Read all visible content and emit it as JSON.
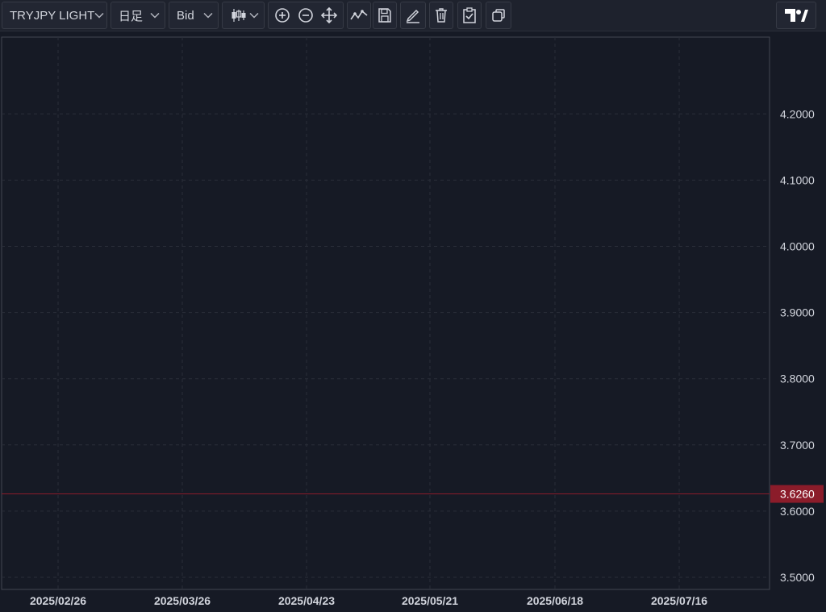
{
  "toolbar": {
    "symbol": "TRYJPY LIGHT",
    "interval": "日足",
    "price_type": "Bid",
    "icons": [
      "candlestick-type-icon",
      "zoom-in-icon",
      "zoom-out-icon",
      "pan-move-icon",
      "drawing-tool-icon",
      "save-icon",
      "edit-icon",
      "delete-icon",
      "checklist-icon",
      "copy-icon"
    ],
    "logo": "TradingView"
  },
  "chart_data": {
    "type": "candlestick",
    "title": "TRYJPY LIGHT",
    "ylim": [
      3.48,
      4.29
    ],
    "y_ticks": [
      "4.2000",
      "4.1000",
      "4.0000",
      "3.9000",
      "3.8000",
      "3.7000",
      "3.6000",
      "3.5000"
    ],
    "x_ticks": [
      "2025/02/26",
      "2025/03/26",
      "2025/04/23",
      "2025/05/21",
      "2025/06/18",
      "2025/07/16"
    ],
    "current_price": 3.626,
    "current_price_label": "3.6260",
    "colors": {
      "up": "#b21a35",
      "down": "#1e9ee6",
      "current_line": "#8b1c2a",
      "grid": "#2a2e39",
      "background": "#161a25"
    },
    "grid": true
  }
}
